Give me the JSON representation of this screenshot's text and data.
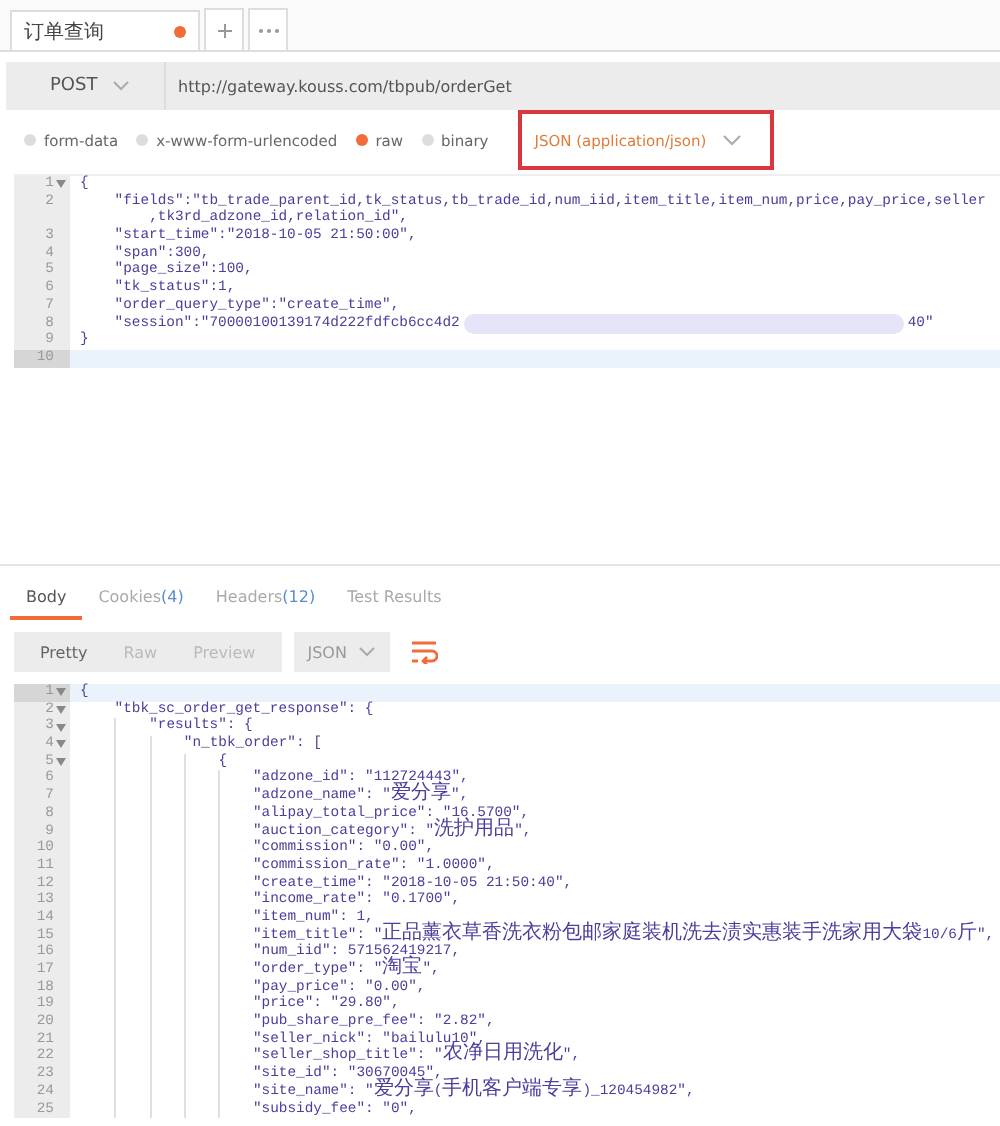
{
  "tabs": [
    {
      "label": "订单查询",
      "unsaved": true,
      "selected": true
    }
  ],
  "request": {
    "method": "POST",
    "url": "http://gateway.kouss.com/tbpub/orderGet",
    "body_types": [
      {
        "label": "form-data",
        "selected": false
      },
      {
        "label": "x-www-form-urlencoded",
        "selected": false
      },
      {
        "label": "raw",
        "selected": true
      },
      {
        "label": "binary",
        "selected": false
      }
    ],
    "content_type": "JSON (application/json)",
    "editor": {
      "lines": [
        {
          "n": "1",
          "text": "{",
          "fold": true,
          "active": false
        },
        {
          "n": "2",
          "text": "    \"fields\":\"tb_trade_parent_id,tk_status,tb_trade_id,num_iid,item_title,item_num,price,pay_price,seller",
          "wrapped": ",tk3rd_adzone_id,relation_id\",",
          "fold": false,
          "active": false
        },
        {
          "n": "3",
          "text": "    \"start_time\":\"2018-10-05 21:50:00\",",
          "fold": false,
          "active": false
        },
        {
          "n": "4",
          "text": "    \"span\":300,",
          "fold": false,
          "active": false
        },
        {
          "n": "5",
          "text": "    \"page_size\":100,",
          "fold": false,
          "active": false
        },
        {
          "n": "6",
          "text": "    \"tk_status\":1,",
          "fold": false,
          "active": false
        },
        {
          "n": "7",
          "text": "    \"order_query_type\":\"create_time\",",
          "fold": false,
          "active": false
        },
        {
          "n": "8",
          "text": "    \"session\":\"70000100139174d222fdfcb6cc4d2",
          "redacted": true,
          "after": "40\"",
          "fold": false,
          "active": false
        },
        {
          "n": "9",
          "text": "}",
          "fold": false,
          "active": false
        },
        {
          "n": "10",
          "fold": false,
          "active": true
        }
      ]
    }
  },
  "response": {
    "tabs": [
      {
        "label": "Body",
        "selected": true
      },
      {
        "label": "Cookies",
        "count": "(4)",
        "selected": false
      },
      {
        "label": "Headers",
        "count": "(12)",
        "selected": false
      },
      {
        "label": "Test Results",
        "selected": false
      }
    ],
    "views": [
      {
        "label": "Pretty",
        "selected": true
      },
      {
        "label": "Raw",
        "selected": false
      },
      {
        "label": "Preview",
        "selected": false
      }
    ],
    "format": "JSON",
    "wrap_on": true,
    "editor": {
      "indent_guides": true,
      "lines": [
        {
          "n": "1",
          "text": "{",
          "fold": true,
          "active": true
        },
        {
          "n": "2",
          "text": "    \"tbk_sc_order_get_response\": {",
          "fold": true,
          "active": false
        },
        {
          "n": "3",
          "text": "        \"results\": {",
          "fold": true,
          "active": false
        },
        {
          "n": "4",
          "text": "            \"n_tbk_order\": [",
          "fold": true,
          "active": false
        },
        {
          "n": "5",
          "text": "                {",
          "fold": true,
          "active": false
        },
        {
          "n": "6",
          "text": "                    \"adzone_id\": \"112724443\",",
          "fold": false,
          "active": false
        },
        {
          "n": "7",
          "text": "                    \"adzone_name\": \"爱分享\",",
          "fold": false,
          "active": false
        },
        {
          "n": "8",
          "text": "                    \"alipay_total_price\": \"16.5700\",",
          "fold": false,
          "active": false
        },
        {
          "n": "9",
          "text": "                    \"auction_category\": \"洗护用品\",",
          "fold": false,
          "active": false
        },
        {
          "n": "10",
          "text": "                    \"commission\": \"0.00\",",
          "fold": false,
          "active": false
        },
        {
          "n": "11",
          "text": "                    \"commission_rate\": \"1.0000\",",
          "fold": false,
          "active": false
        },
        {
          "n": "12",
          "text": "                    \"create_time\": \"2018-10-05 21:50:40\",",
          "fold": false,
          "active": false
        },
        {
          "n": "13",
          "text": "                    \"income_rate\": \"0.1700\",",
          "fold": false,
          "active": false
        },
        {
          "n": "14",
          "text": "                    \"item_num\": 1,",
          "fold": false,
          "active": false
        },
        {
          "n": "15",
          "text": "                    \"item_title\": \"正品薰衣草香洗衣粉包邮家庭装机洗去渍实惠装手洗家用大袋10/6斤\",",
          "fold": false,
          "active": false
        },
        {
          "n": "16",
          "text": "                    \"num_iid\": 571562419217,",
          "fold": false,
          "active": false
        },
        {
          "n": "17",
          "text": "                    \"order_type\": \"淘宝\",",
          "fold": false,
          "active": false
        },
        {
          "n": "18",
          "text": "                    \"pay_price\": \"0.00\",",
          "fold": false,
          "active": false
        },
        {
          "n": "19",
          "text": "                    \"price\": \"29.80\",",
          "fold": false,
          "active": false
        },
        {
          "n": "20",
          "text": "                    \"pub_share_pre_fee\": \"2.82\",",
          "fold": false,
          "active": false
        },
        {
          "n": "21",
          "text": "                    \"seller_nick\": \"bailulu10\",",
          "fold": false,
          "active": false
        },
        {
          "n": "22",
          "text": "                    \"seller_shop_title\": \"农净日用洗化\",",
          "fold": false,
          "active": false
        },
        {
          "n": "23",
          "text": "                    \"site_id\": \"30670045\",",
          "fold": false,
          "active": false
        },
        {
          "n": "24",
          "text": "                    \"site_name\": \"爱分享(手机客户端专享)_120454982\",",
          "fold": false,
          "active": false
        },
        {
          "n": "25",
          "text": "                    \"subsidy_fee\": \"0\",",
          "fold": false,
          "active": false
        }
      ]
    }
  }
}
